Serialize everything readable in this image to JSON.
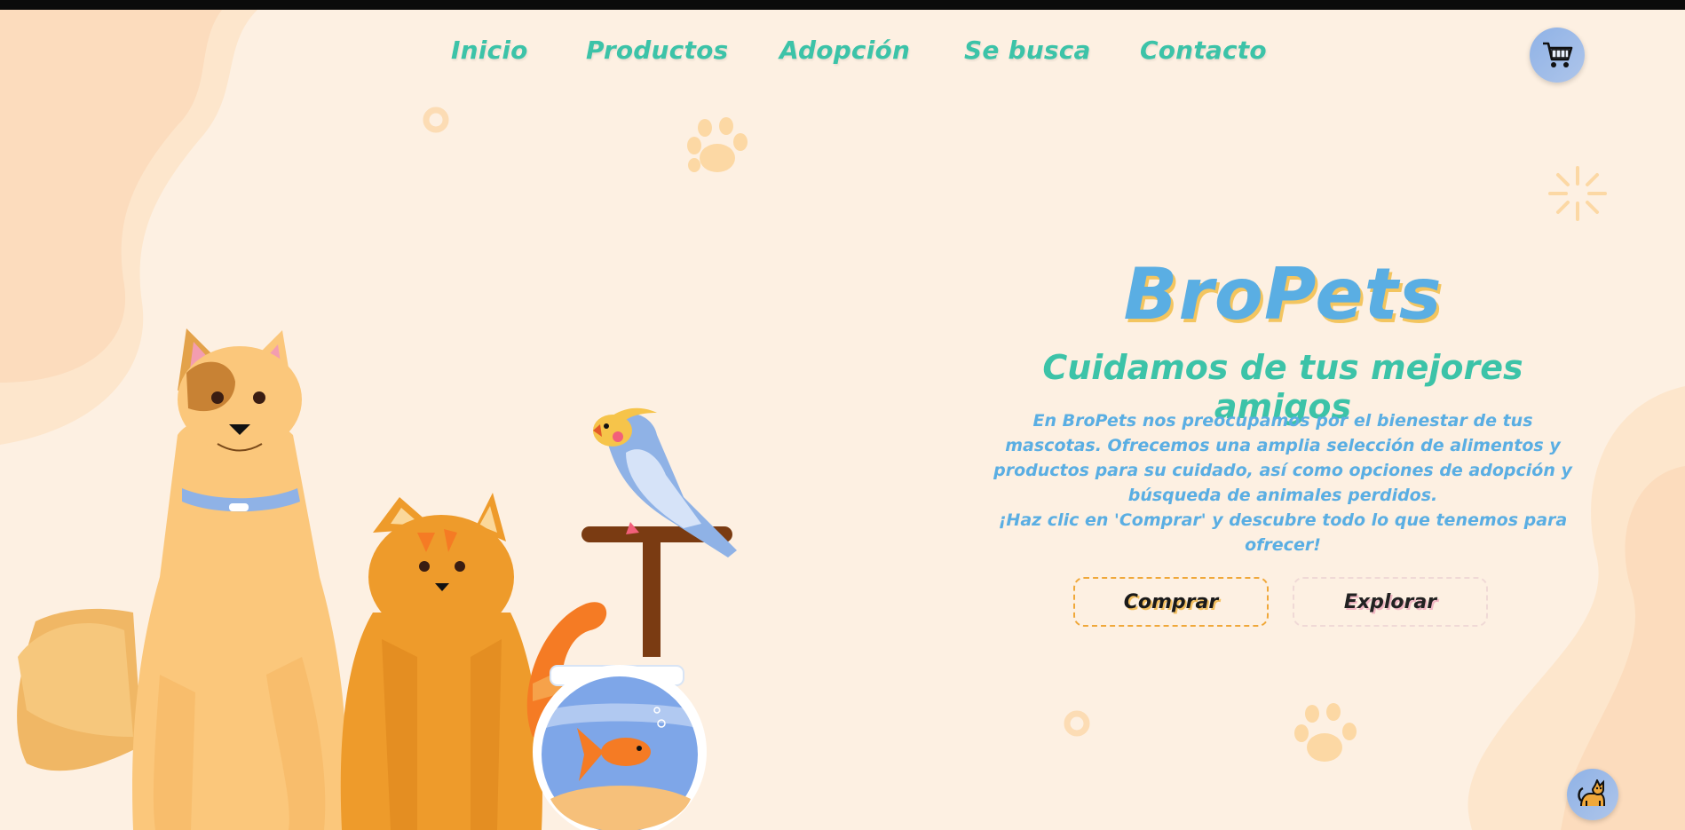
{
  "nav": {
    "items": [
      {
        "label": "Inicio"
      },
      {
        "label": "Productos"
      },
      {
        "label": "Adopción"
      },
      {
        "label": "Se busca"
      },
      {
        "label": "Contacto"
      }
    ]
  },
  "hero": {
    "brand": "BroPets",
    "tagline": "Cuidamos de tus mejores amigos",
    "description_1": "En BroPets nos preocupamos por el bienestar de tus mascotas. Ofrecemos una amplia selección de alimentos y productos para su cuidado, así como opciones de adopción y búsqueda de animales perdidos.",
    "description_2": "¡Haz clic en 'Comprar' y descubre todo lo que tenemos para ofrecer!",
    "buy_label": "Comprar",
    "explore_label": "Explorar"
  },
  "icons": {
    "cart": "cart-icon",
    "pet": "cat-icon"
  },
  "colors": {
    "background": "#fdf0e2",
    "nav_text": "#3cc3a8",
    "brand": "#5aaee3",
    "brand_shadow": "#f3c55f",
    "accent_orange": "#f0a83a"
  }
}
